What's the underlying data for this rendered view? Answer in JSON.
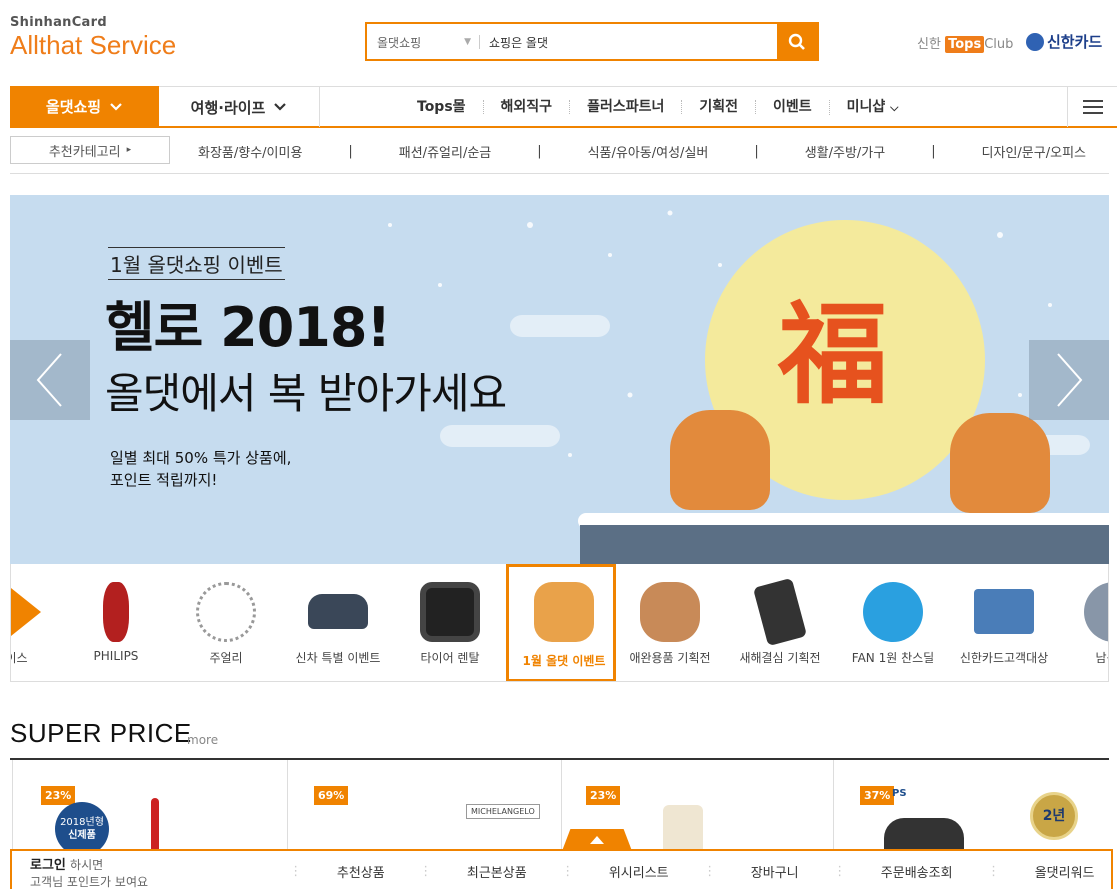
{
  "header": {
    "brand_top": "ShinhanCard",
    "brand_main": "Allthat Service",
    "search": {
      "category": "올댓쇼핑",
      "query": "쇼핑은 올댓"
    },
    "tops_club_prefix": "신한",
    "tops_club_tag": "Tops",
    "tops_club_suffix": "Club",
    "shinhan_card": "신한카드"
  },
  "gnb": {
    "primary": "올댓쇼핑",
    "secondary": "여행·라이프",
    "menu": [
      "Tops몰",
      "해외직구",
      "플러스파트너",
      "기획전",
      "이벤트",
      "미니샵"
    ]
  },
  "subnav": {
    "recommend": "추천카테고리",
    "categories": [
      "화장품/향수/이미용",
      "패션/쥬얼리/순금",
      "식품/유아동/여성/실버",
      "생활/주방/가구",
      "디자인/문구/오피스"
    ]
  },
  "banner": {
    "eyebrow": "1월 올댓쇼핑 이벤트",
    "headline": "헬로 2018!",
    "subhead": "올댓에서 복 받아가세요",
    "desc_line1": "일별 최대 50% 특가 상품에,",
    "desc_line2": "포인트 적립까지!",
    "glyph": "福"
  },
  "strip": {
    "items": [
      "라이스",
      "PHILIPS",
      "주얼리",
      "신차 특별 이벤트",
      "타이어 렌탈",
      "1월 올댓 이벤트",
      "애완용품 기획전",
      "새해결심 기획전",
      "FAN 1원 찬스딜",
      "신한카드고객대상",
      "남성 의"
    ],
    "selected_index": 5
  },
  "superprice": {
    "title": "SUPER PRICE",
    "more": "more",
    "badges": [
      "23%",
      "69%",
      "23%",
      "37%"
    ],
    "p1_tag_year": "2018년형",
    "p1_tag_new": "신제품",
    "p2_brand": "MICHELANGELO",
    "p4_brand": "PS",
    "p4_warranty": "2년"
  },
  "bottom": {
    "login": "로그인",
    "login_suffix": "하시면",
    "login_sub": "고객님 포인트가 보여요",
    "nav": [
      "추천상품",
      "최근본상품",
      "위시리스트",
      "장바구니",
      "주문배송조회",
      "올댓리워드"
    ]
  }
}
